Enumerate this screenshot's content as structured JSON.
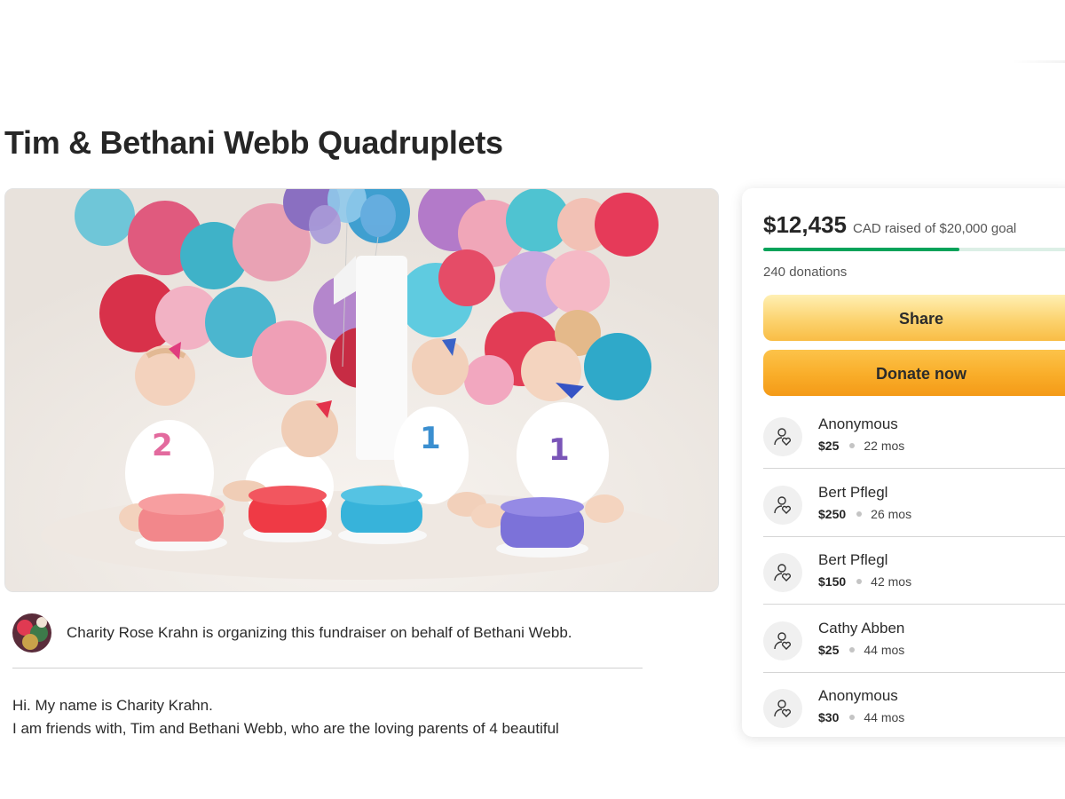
{
  "campaign": {
    "title": "Tim & Bethani Webb Quadruplets"
  },
  "organizer": {
    "text": "Charity Rose Krahn is organizing this fundraiser on behalf of Bethani Webb."
  },
  "story": {
    "line1": "Hi. My name is Charity Krahn.",
    "line2": "I am friends with, Tim and Bethani Webb, who are the loving parents of 4 beautiful"
  },
  "card": {
    "amount": "$12,435",
    "amount_suffix": "CAD raised of $20,000 goal",
    "progress_fraction": 0.622,
    "donation_count": "240 donations",
    "share_label": "Share",
    "donate_label": "Donate now",
    "colors": {
      "progress": "#04a35a",
      "donate": "#f9ad29",
      "share": "#fcd36f"
    }
  },
  "donations": [
    {
      "name": "Anonymous",
      "amount": "$25",
      "time": "22 mos",
      "icon": "donor-heart-icon"
    },
    {
      "name": "Bert Pflegl",
      "amount": "$250",
      "time": "26 mos",
      "icon": "donor-heart-icon"
    },
    {
      "name": "Bert Pflegl",
      "amount": "$150",
      "time": "42 mos",
      "icon": "donor-heart-icon"
    },
    {
      "name": "Cathy Abben",
      "amount": "$25",
      "time": "44 mos",
      "icon": "donor-heart-icon"
    },
    {
      "name": "Anonymous",
      "amount": "$30",
      "time": "44 mos",
      "icon": "donor-heart-icon"
    }
  ]
}
